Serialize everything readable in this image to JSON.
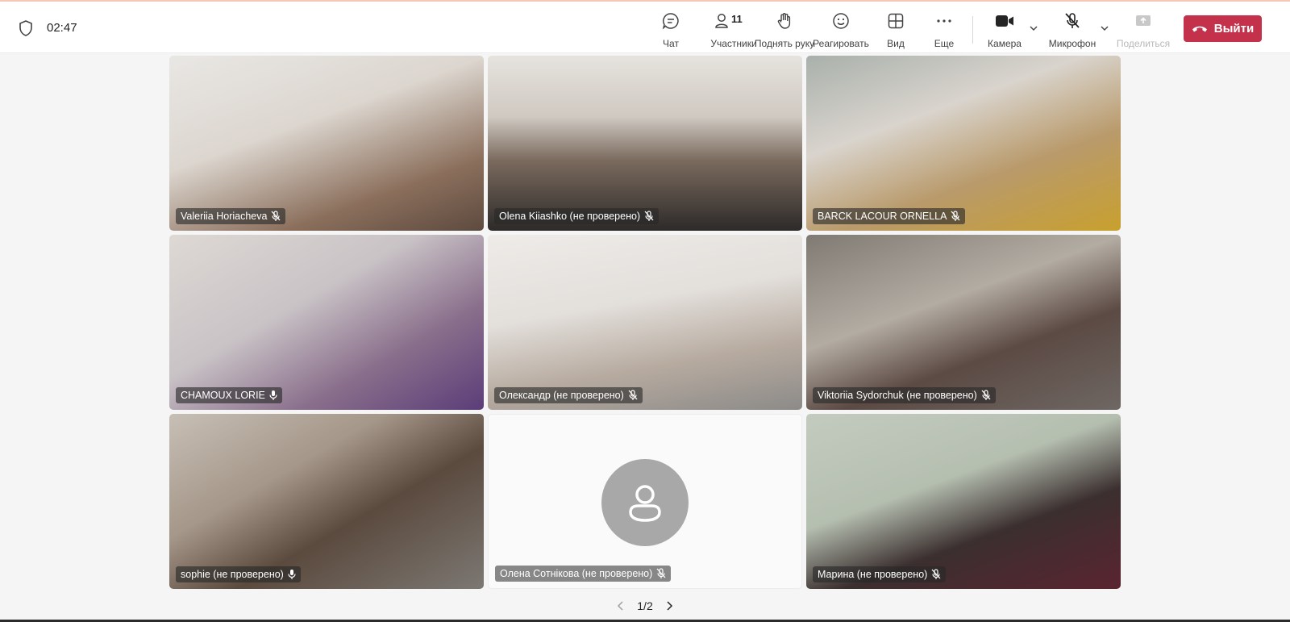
{
  "meeting": {
    "timer": "02:47"
  },
  "toolbar": {
    "chat_label": "Чат",
    "participants_label": "Участники",
    "participants_count": "11",
    "raise_hand_label": "Поднять руку",
    "react_label": "Реагировать",
    "view_label": "Вид",
    "more_label": "Еще",
    "camera_label": "Камера",
    "mic_label": "Микрофон",
    "share_label": "Поделиться",
    "leave_label": "Выйти"
  },
  "colors": {
    "leave_button": "#c4314b",
    "avatar_bg": "#a8a8a8",
    "toolbar_bg": "#ffffff"
  },
  "participants": [
    {
      "name": "Valeriia Horiacheva",
      "mic": "muted"
    },
    {
      "name": "Olena Kiiashko (не проверено)",
      "mic": "muted"
    },
    {
      "name": "BARCK LACOUR ORNELLA",
      "mic": "muted"
    },
    {
      "name": "CHAMOUX LORIE",
      "mic": "on"
    },
    {
      "name": "Олександр (не проверено)",
      "mic": "muted"
    },
    {
      "name": "Viktoriia Sydorchuk (не проверено)",
      "mic": "muted"
    },
    {
      "name": "sophie (не проверено)",
      "mic": "on"
    },
    {
      "name": "Олена Сотнікова (не проверено)",
      "mic": "muted"
    },
    {
      "name": "Марина (не проверено)",
      "mic": "muted"
    }
  ],
  "pagination": {
    "label": "1/2"
  }
}
